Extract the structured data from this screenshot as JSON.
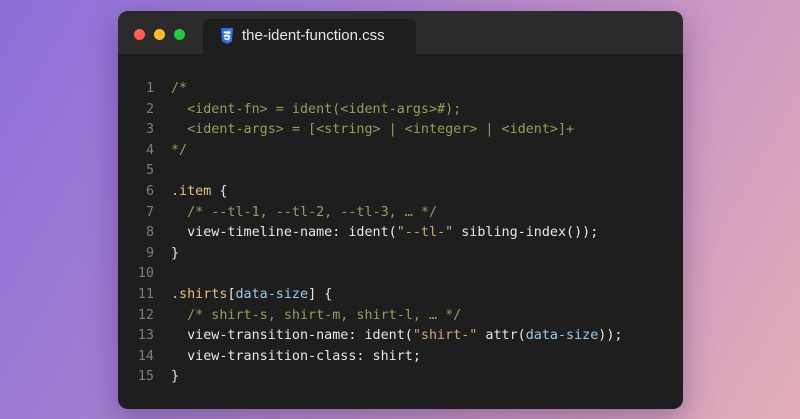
{
  "window": {
    "tab_title": "the-ident-function.css",
    "file_icon": "css3-icon"
  },
  "colors": {
    "close": "#ff5f57",
    "minimize": "#febc2e",
    "maximize": "#28c840",
    "comment": "#8ea05a",
    "string": "#d2a774",
    "selector": "#e8c07c",
    "attribute": "#9ccbe8",
    "text": "#e6e6e6",
    "line_number": "#7d7d7d",
    "css_icon": "#2f6bd8"
  },
  "code": {
    "lines": [
      {
        "num": "1",
        "parts": [
          {
            "t": "/*",
            "c": "c"
          }
        ]
      },
      {
        "num": "2",
        "parts": [
          {
            "t": "  <ident-fn> = ident(<ident-args>#);",
            "c": "c"
          }
        ]
      },
      {
        "num": "3",
        "parts": [
          {
            "t": "  <ident-args> = [<string> | <integer> | <ident>]+",
            "c": "c"
          }
        ]
      },
      {
        "num": "4",
        "parts": [
          {
            "t": "*/",
            "c": "c"
          }
        ]
      },
      {
        "num": "5",
        "parts": []
      },
      {
        "num": "6",
        "parts": [
          {
            "t": ".item",
            "c": "sel"
          },
          {
            "t": " {",
            "c": ""
          }
        ]
      },
      {
        "num": "7",
        "parts": [
          {
            "t": "  /* --tl-1, --tl-2, --tl-3, … */",
            "c": "c"
          }
        ]
      },
      {
        "num": "8",
        "parts": [
          {
            "t": "  view-timeline-name: ident(",
            "c": ""
          },
          {
            "t": "\"--tl-\"",
            "c": "s"
          },
          {
            "t": " sibling-index());",
            "c": ""
          }
        ]
      },
      {
        "num": "9",
        "parts": [
          {
            "t": "}",
            "c": ""
          }
        ]
      },
      {
        "num": "10",
        "parts": []
      },
      {
        "num": "11",
        "parts": [
          {
            "t": ".shirts",
            "c": "sel"
          },
          {
            "t": "[",
            "c": ""
          },
          {
            "t": "data-size",
            "c": "attr"
          },
          {
            "t": "] {",
            "c": ""
          }
        ]
      },
      {
        "num": "12",
        "parts": [
          {
            "t": "  /* shirt-s, shirt-m, shirt-l, … */",
            "c": "c"
          }
        ]
      },
      {
        "num": "13",
        "parts": [
          {
            "t": "  view-transition-name: ident(",
            "c": ""
          },
          {
            "t": "\"shirt-\"",
            "c": "s"
          },
          {
            "t": " attr(",
            "c": ""
          },
          {
            "t": "data-size",
            "c": "attr"
          },
          {
            "t": "));",
            "c": ""
          }
        ]
      },
      {
        "num": "14",
        "parts": [
          {
            "t": "  view-transition-class: shirt;",
            "c": ""
          }
        ]
      },
      {
        "num": "15",
        "parts": [
          {
            "t": "}",
            "c": ""
          }
        ]
      }
    ]
  }
}
